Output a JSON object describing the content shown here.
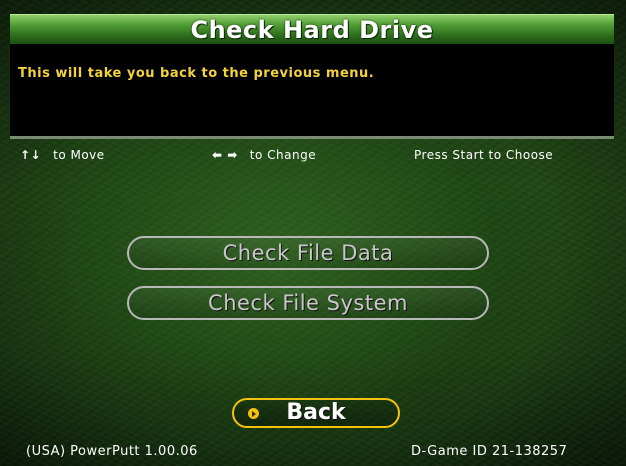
{
  "header": {
    "title": "Check Hard Drive"
  },
  "description": {
    "text": "This will take you back to the previous menu."
  },
  "hints": {
    "move_arrows": "↑↓",
    "move_label": "to Move",
    "change_arrows": "⬅ ➡",
    "change_label": "to Change",
    "choose_label": "Press Start to Choose"
  },
  "menu": {
    "items": [
      {
        "label": "Check File Data"
      },
      {
        "label": "Check File System"
      }
    ],
    "back_label": "Back"
  },
  "footer": {
    "version": "(USA) PowerPutt 1.00.06",
    "game_id": "D-Game ID 21-138257"
  },
  "colors": {
    "title_green": "#4d9a32",
    "description_yellow": "#f2d23a",
    "selected_border": "#f4c20d",
    "button_border": "#b8b8b8"
  }
}
